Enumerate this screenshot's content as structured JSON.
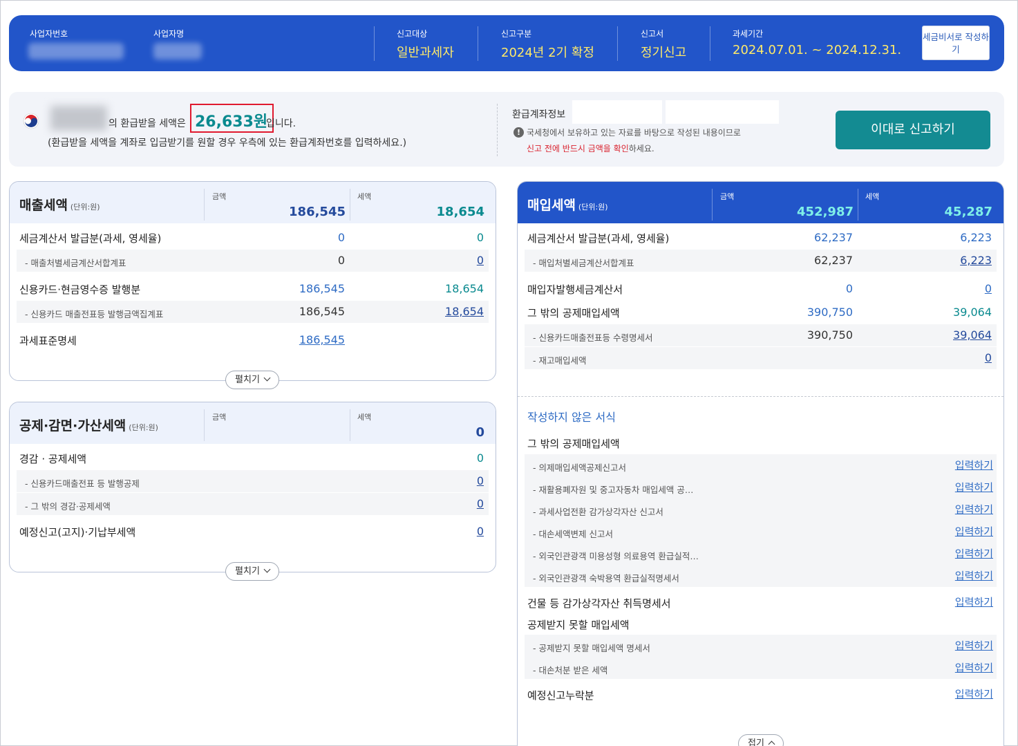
{
  "header": {
    "biz_no_label": "사업자번호",
    "biz_name_label": "사업자명",
    "target_label": "신고대상",
    "target_value": "일반과세자",
    "type_label": "신고구분",
    "type_value": "2024년 2기 확정",
    "form_label": "신고서",
    "form_value": "정기신고",
    "period_label": "과세기간",
    "period_value": "2024.07.01. ~ 2024.12.31.",
    "tax_secretary_button": "세금비서로 작성하기"
  },
  "summary": {
    "text_before": "의 환급받을 세액은",
    "amount": "26,633원",
    "text_after": "입니다.",
    "note": "(환급받을 세액을 계좌로 입금받기를 원할 경우 우측에 있는 환급계좌번호를 입력하세요.)",
    "account_label": "환급계좌정보",
    "warning_line1": "국세청에서 보유하고 있는 자료를 바탕으로 작성된 내용이므로",
    "warning_red": "신고 전에 반드시 금액을 확인",
    "warning_suffix": "하세요.",
    "submit_button": "이대로 신고하기",
    "flag_icon": "korea-flag-icon",
    "warning_icon": "exclamation-circle-icon"
  },
  "sales": {
    "title": "매출세액",
    "unit": "(단위:원)",
    "col_amount": "금액",
    "col_tax": "세액",
    "total_amount": "186,545",
    "total_tax": "18,654",
    "rows": [
      {
        "label": "세금계산서 발급분(과세, 영세율)",
        "amount": "0",
        "tax": "0"
      },
      {
        "label": "- 매출처별세금계산서합계표",
        "amount": "0",
        "tax": "0"
      },
      {
        "label": "신용카드·현금영수증 발행분",
        "amount": "186,545",
        "tax": "18,654"
      },
      {
        "label": "- 신용카드 매출전표등 발행금액집계표",
        "amount": "186,545",
        "tax": "18,654"
      },
      {
        "label": "과세표준명세",
        "amount": "186,545"
      }
    ],
    "expand": "펼치기"
  },
  "deduction": {
    "title": "공제·감면·가산세액",
    "unit": "(단위:원)",
    "col_amount": "금액",
    "col_tax": "세액",
    "total_tax": "0",
    "rows": [
      {
        "label": "경감 · 공제세액",
        "tax": "0"
      },
      {
        "label": "- 신용카드매출전표 등 발행공제",
        "tax": "0"
      },
      {
        "label": "- 그 밖의 경감·공제세액",
        "tax": "0"
      },
      {
        "label": "예정신고(고지)·기납부세액",
        "tax": "0"
      }
    ],
    "expand": "펼치기"
  },
  "purchase": {
    "title": "매입세액",
    "unit": "(단위:원)",
    "col_amount": "금액",
    "col_tax": "세액",
    "total_amount": "452,987",
    "total_tax": "45,287",
    "rows": [
      {
        "label": "세금계산서 발급분(과세, 영세율)",
        "amount": "62,237",
        "tax": "6,223"
      },
      {
        "label": "- 매입처별세금계산서합계표",
        "amount": "62,237",
        "tax": "6,223"
      },
      {
        "label": "매입자발행세금계산서",
        "amount": "0",
        "tax": "0"
      },
      {
        "label": "그 밖의 공제매입세액",
        "amount": "390,750",
        "tax": "39,064"
      },
      {
        "label": "- 신용카드매출전표등 수령명세서",
        "amount": "390,750",
        "tax": "39,064"
      },
      {
        "label": "- 재고매입세액",
        "tax": "0"
      }
    ],
    "unwritten_title": "작성하지 않은 서식",
    "input_label": "입력하기",
    "unwritten": [
      {
        "label": "그 밖의 공제매입세액"
      },
      {
        "label": "- 의제매입세액공제신고서"
      },
      {
        "label": "- 재활용폐자원 및 중고자동차 매입세액 공…"
      },
      {
        "label": "- 과세사업전환 감가상각자산 신고서"
      },
      {
        "label": "- 대손세액변제 신고서"
      },
      {
        "label": "- 외국인관광객 미용성형 의료용역 환급실적…"
      },
      {
        "label": "- 외국인관광객 숙박용역 환급실적명세서"
      },
      {
        "label": "건물 등 감가상각자산 취득명세서"
      },
      {
        "label": "공제받지 못할 매입세액"
      },
      {
        "label": "- 공제받지 못할 매입세액 명세서"
      },
      {
        "label": "- 대손처분 받은 세액"
      },
      {
        "label": "예정신고누락분"
      }
    ],
    "collapse": "접기"
  }
}
